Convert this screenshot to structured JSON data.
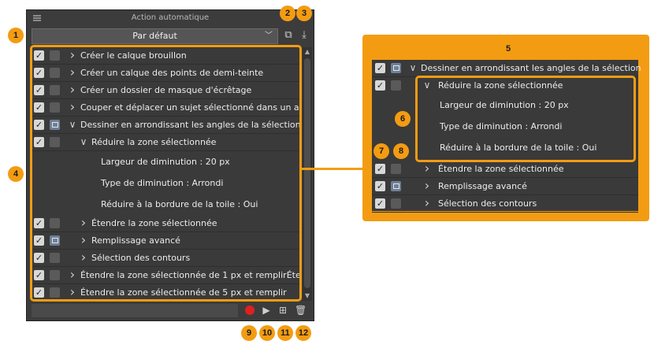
{
  "panel": {
    "title": "Action automatique",
    "dropdown_value": "Par défaut",
    "icons": {
      "menu": "menu-icon",
      "copy": "copy-set-icon",
      "import": "import-icon"
    }
  },
  "list": {
    "rows": [
      {
        "checked": true,
        "dialog": false,
        "expanded": false,
        "label": "Créer le calque brouillon"
      },
      {
        "checked": true,
        "dialog": false,
        "expanded": false,
        "label": "Créer un calque des points de demi-teinte"
      },
      {
        "checked": true,
        "dialog": false,
        "expanded": false,
        "label": "Créer un dossier de masque d'écrêtage"
      },
      {
        "checked": true,
        "dialog": false,
        "expanded": false,
        "label": "Couper et déplacer un sujet sélectionné dans un autr"
      },
      {
        "checked": true,
        "dialog": true,
        "expanded": true,
        "label": "Dessiner en arrondissant les angles de la sélection"
      },
      {
        "checked": true,
        "dialog": false,
        "expanded": true,
        "label": "Réduire la zone sélectionnée"
      },
      {
        "detail": "Largeur de diminution : 20 px"
      },
      {
        "detail": "Type de diminution : Arrondi"
      },
      {
        "detail": "Réduire à la bordure de la toile : Oui"
      },
      {
        "checked": true,
        "dialog": false,
        "expanded": false,
        "label": "Étendre la zone sélectionnée"
      },
      {
        "checked": true,
        "dialog": true,
        "expanded": false,
        "label": "Remplissage avancé"
      },
      {
        "checked": true,
        "dialog": false,
        "expanded": false,
        "label": "Sélection des contours"
      },
      {
        "checked": true,
        "dialog": false,
        "expanded": false,
        "label": "Étendre la zone sélectionnée de 1 px et remplirÉtend"
      },
      {
        "checked": true,
        "dialog": false,
        "expanded": false,
        "label": "Étendre la zone sélectionnée de 5 px et remplir"
      }
    ]
  },
  "zoom": {
    "header": "Dessiner en arrondissant les angles de la sélection",
    "sub": "Réduire la zone sélectionnée",
    "details": [
      "Largeur de diminution : 20 px",
      "Type de diminution : Arrondi",
      "Réduire à la bordure de la toile : Oui"
    ],
    "rows": [
      "Étendre la zone sélectionnée",
      "Remplissage avancé",
      "Sélection des contours"
    ]
  },
  "badges": [
    "1",
    "2",
    "3",
    "4",
    "5",
    "6",
    "7",
    "8",
    "9",
    "10",
    "11",
    "12"
  ],
  "colors": {
    "accent": "#f39c12",
    "record": "#e02020",
    "panel": "#3c3c3c"
  }
}
